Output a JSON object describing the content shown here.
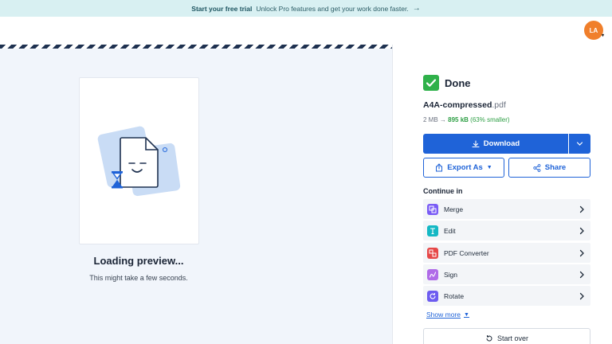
{
  "promo": {
    "strong": "Start your free trial",
    "text": "Unlock Pro features and get your work done faster.",
    "arrow": "→"
  },
  "user": {
    "initials": "LA",
    "avatar_color": "#f07f2b"
  },
  "preview": {
    "title": "Loading preview...",
    "subtitle": "This might take a few seconds.",
    "illustration": "document-waiting-icon"
  },
  "result": {
    "status": "Done",
    "status_icon": "check-icon",
    "file_base": "A4A-compressed",
    "file_ext": ".pdf",
    "original_size": "2 MB",
    "arrow": "→",
    "new_size": "895 kB",
    "reduction": "(63% smaller)"
  },
  "actions": {
    "download": "Download",
    "export": "Export As",
    "share": "Share",
    "start_over": "Start over"
  },
  "continue": {
    "heading": "Continue in",
    "tools": [
      {
        "label": "Merge",
        "icon": "merge-icon",
        "color": "#7a5cf5"
      },
      {
        "label": "Edit",
        "icon": "edit-icon",
        "color": "#14b8c4"
      },
      {
        "label": "PDF Converter",
        "icon": "converter-icon",
        "color": "#e64848"
      },
      {
        "label": "Sign",
        "icon": "sign-icon",
        "color": "#b06be8"
      },
      {
        "label": "Rotate",
        "icon": "rotate-icon",
        "color": "#6d5cf0"
      }
    ],
    "show_more": "Show more"
  },
  "colors": {
    "primary": "#1f63d8",
    "success": "#2fb14a",
    "promo_bg": "#d8f0f2",
    "preview_bg": "#f1f5fb"
  }
}
